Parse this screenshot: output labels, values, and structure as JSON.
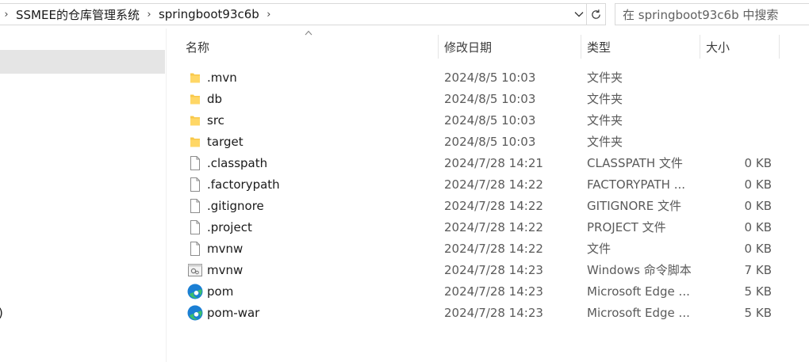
{
  "address": {
    "crumbs": [
      "SSMEE的仓库管理系统",
      "springboot93c6b"
    ],
    "search_placeholder": "在 springboot93c6b 中搜索"
  },
  "nav": {
    "fragment_text": ")"
  },
  "columns": {
    "name": "名称",
    "date": "修改日期",
    "type": "类型",
    "size": "大小"
  },
  "files": [
    {
      "name": ".mvn",
      "date": "2024/8/5 10:03",
      "type": "文件夹",
      "size": "",
      "icon": "folder-icon"
    },
    {
      "name": "db",
      "date": "2024/8/5 10:03",
      "type": "文件夹",
      "size": "",
      "icon": "folder-icon"
    },
    {
      "name": "src",
      "date": "2024/8/5 10:03",
      "type": "文件夹",
      "size": "",
      "icon": "folder-icon"
    },
    {
      "name": "target",
      "date": "2024/8/5 10:03",
      "type": "文件夹",
      "size": "",
      "icon": "folder-icon"
    },
    {
      "name": ".classpath",
      "date": "2024/7/28 14:21",
      "type": "CLASSPATH 文件",
      "size": "0 KB",
      "icon": "file-icon"
    },
    {
      "name": ".factorypath",
      "date": "2024/7/28 14:22",
      "type": "FACTORYPATH ...",
      "size": "0 KB",
      "icon": "file-icon"
    },
    {
      "name": ".gitignore",
      "date": "2024/7/28 14:22",
      "type": "GITIGNORE 文件",
      "size": "0 KB",
      "icon": "file-icon"
    },
    {
      "name": ".project",
      "date": "2024/7/28 14:22",
      "type": "PROJECT 文件",
      "size": "0 KB",
      "icon": "file-icon"
    },
    {
      "name": "mvnw",
      "date": "2024/7/28 14:22",
      "type": "文件",
      "size": "0 KB",
      "icon": "file-icon"
    },
    {
      "name": "mvnw",
      "date": "2024/7/28 14:23",
      "type": "Windows 命令脚本",
      "size": "7 KB",
      "icon": "script-icon"
    },
    {
      "name": "pom",
      "date": "2024/7/28 14:23",
      "type": "Microsoft Edge ...",
      "size": "5 KB",
      "icon": "edge-icon"
    },
    {
      "name": "pom-war",
      "date": "2024/7/28 14:23",
      "type": "Microsoft Edge ...",
      "size": "5 KB",
      "icon": "edge-icon"
    }
  ],
  "colors": {
    "folder": "#f8c84a",
    "edge_blue": "#1b7fd4",
    "edge_green": "#3bbf6a",
    "selection": "#e5e5e5"
  }
}
